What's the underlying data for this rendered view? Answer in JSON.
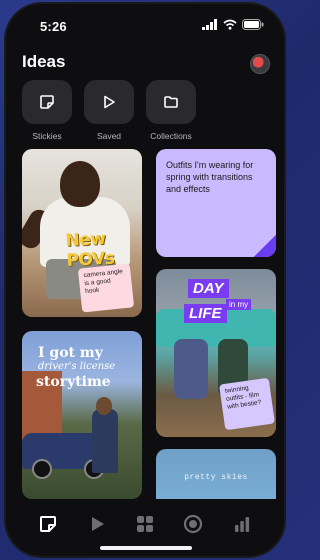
{
  "status": {
    "time": "5:26"
  },
  "header": {
    "title": "Ideas"
  },
  "quick_actions": [
    {
      "label": "Stickies",
      "icon": "sticky-note-icon"
    },
    {
      "label": "Saved",
      "icon": "play-icon"
    },
    {
      "label": "Collections",
      "icon": "folder-icon"
    }
  ],
  "cards": {
    "card1": {
      "overlay": "New POVs",
      "note": "camera angle is a good hook"
    },
    "card2": {
      "text": "Outfits I'm wearing for spring with transitions and effects"
    },
    "card3": {
      "day": "DAY",
      "inmy": "in my",
      "life": "LIFE",
      "note": "twinning outfits - film with bestie?"
    },
    "card4": {
      "line1": "I got my",
      "line2": "driver's license",
      "line3": "storytime"
    },
    "card5": {
      "text": "pretty skies"
    }
  },
  "tabbar": [
    {
      "icon": "stickies-tab-icon",
      "active": true
    },
    {
      "icon": "play-tab-icon"
    },
    {
      "icon": "grid-tab-icon"
    },
    {
      "icon": "record-tab-icon"
    },
    {
      "icon": "analytics-tab-icon"
    }
  ],
  "colors": {
    "accent_purple": "#7a3cf0",
    "sticky_purple": "#c9b9ff",
    "sticky_pink": "#ffd9e2"
  }
}
